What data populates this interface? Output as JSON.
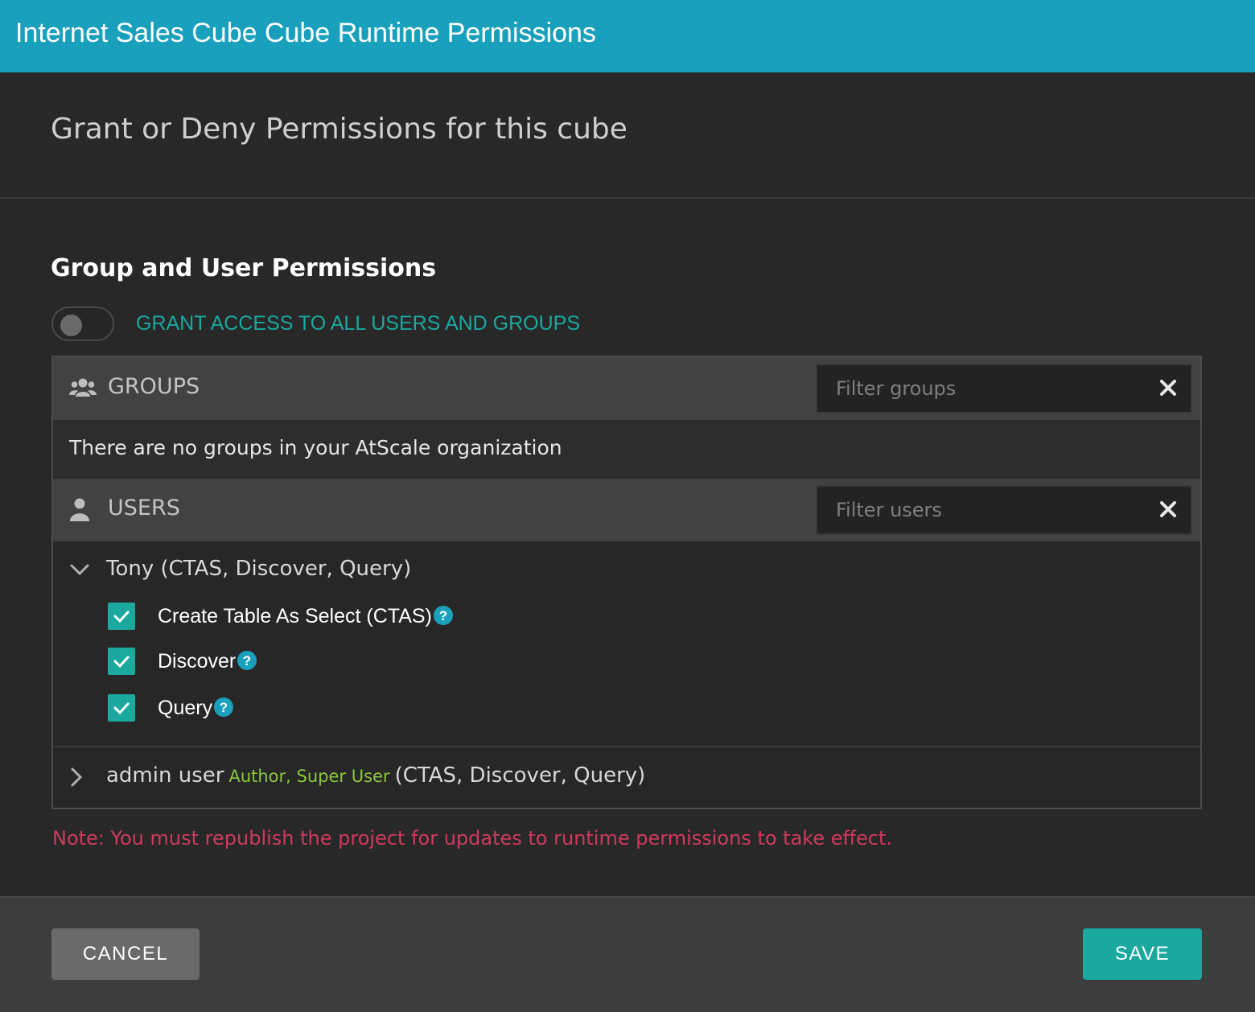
{
  "window": {
    "title": "Internet Sales Cube Cube Runtime Permissions"
  },
  "subtitle": "Grant or Deny Permissions for this cube",
  "section": {
    "heading": "Group and User Permissions",
    "toggle": {
      "label": "GRANT ACCESS TO ALL USERS AND GROUPS",
      "on": false
    }
  },
  "groups": {
    "header": "GROUPS",
    "filter_placeholder": "Filter groups",
    "empty_message": "There are no groups in your AtScale organization"
  },
  "users": {
    "header": "USERS",
    "filter_placeholder": "Filter users",
    "items": [
      {
        "name": "Tony (CTAS, Discover, Query)",
        "expanded": true,
        "permissions": [
          {
            "label": "Create Table As Select (CTAS)",
            "checked": true
          },
          {
            "label": "Discover",
            "checked": true
          },
          {
            "label": "Query",
            "checked": true
          }
        ]
      },
      {
        "name": "admin user",
        "roles": "Author, Super User",
        "perms_summary": "(CTAS, Discover, Query)",
        "expanded": false
      }
    ]
  },
  "note": "Note: You must republish the project for updates to runtime permissions to take effect.",
  "footer": {
    "cancel_label": "CANCEL",
    "save_label": "SAVE"
  },
  "colors": {
    "title_bar": "#19a0bd",
    "accent_teal": "#1aa89f",
    "role_green": "#8cc63f",
    "note_red": "#d03a5c",
    "background": "#282828"
  }
}
